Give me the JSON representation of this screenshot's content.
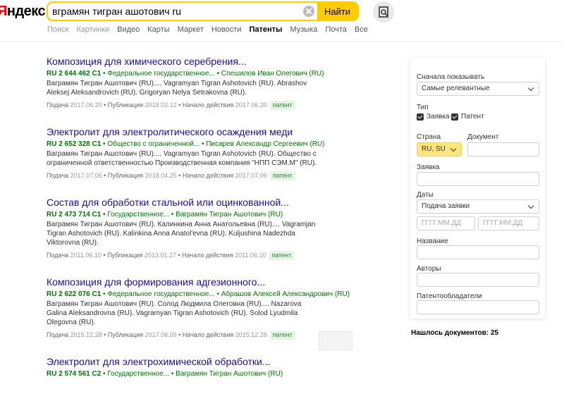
{
  "header": {
    "logo_first_letter": "Я",
    "logo_rest": "ндекс",
    "query": "вграмян тигран ашотович ru",
    "search_button": "Найти"
  },
  "tabs": [
    {
      "label": "Поиск",
      "state": "muted"
    },
    {
      "label": "Картинки",
      "state": "muted"
    },
    {
      "label": "Видео",
      "state": "normal"
    },
    {
      "label": "Карты",
      "state": "normal"
    },
    {
      "label": "Маркет",
      "state": "normal"
    },
    {
      "label": "Новости",
      "state": "normal"
    },
    {
      "label": "Патенты",
      "state": "active"
    },
    {
      "label": "Музыка",
      "state": "normal"
    },
    {
      "label": "Почта",
      "state": "normal"
    },
    {
      "label": "Все",
      "state": "normal"
    }
  ],
  "results": [
    {
      "title": "Композиция для химического серебрения...",
      "number": "RU 2 644 462 C1",
      "meta": " • Федеральное государственное... • Спешилов Иван Олегович (RU)",
      "authors": "Ваграмян Тигран Ашотович (RU).... Vagramyan Tigran Ashotovich (RU). Abrashov Aleksej Aleksandrovich (RU). Grigoryan Nelya Setrakovna (RU).",
      "filed_label": "Подача",
      "filed": "2017.06.20",
      "pub_label": "Публикация",
      "pub": "2018.02.12",
      "start_label": "Начало действия",
      "start": "2017.06.20",
      "badge": "патент"
    },
    {
      "title": "Электролит для электролитического осаждения меди",
      "number": "RU 2 652 328 C1",
      "meta": " • Общество с ограниченной... • Писарев Александр Сергеевич (RU)",
      "authors": "Ваграмян Тигран Ашотович (RU).... Vagramyan Tigran Ashotovich (RU). Общество с ограниченной ответственностью Производственная компания \"НПП СЭМ.М\" (RU).",
      "filed_label": "Подача",
      "filed": "2017.07.06",
      "pub_label": "Публикация",
      "pub": "2018.04.25",
      "start_label": "Начало действия",
      "start": "2017.07.06",
      "badge": "патент"
    },
    {
      "title": "Состав для обработки стальной или оцинкованной...",
      "number": "RU 2 473 714 C1",
      "meta": " • Государственное... • Ваграмян Тигран Ашотович (RU)",
      "authors": "Ваграмян Тигран Ашотович (RU). Калинкина Анна Анатольевна (RU).... Vagramjan Tigran Ashotovich (RU). Kalinkina Anna Anatol'evna (RU). Kuljushina Nadezhda Viktorovna (RU).",
      "filed_label": "Подача",
      "filed": "2011.06.10",
      "pub_label": "Публикация",
      "pub": "2013.01.27",
      "start_label": "Начало действия",
      "start": "2011.06.10",
      "badge": "патент"
    },
    {
      "title": "Композиция для формирования адгезионного...",
      "number": "RU 2 622 076 C1",
      "meta": " • Федеральное государственное... • Абрашов Алексей Александрович (RU)",
      "authors": "Ваграмян Тигран Ашотович (RU). Солод Людмила Олеговна (RU).... Nazarova Galina Aleksandrovna (RU). Vagramyan Tigran Ashotovich (RU). Solod Lyudmila Olegovna (RU).",
      "filed_label": "Подача",
      "filed": "2015.12.28",
      "pub_label": "Публикация",
      "pub": "2017.06.09",
      "start_label": "Начало действия",
      "start": "2015.12.28",
      "badge": "патент"
    },
    {
      "title": "Электролит для электрохимической обработки...",
      "number": "RU 2 574 561 C2",
      "meta": " • Государственное... • Ваграмян Тигран Ашотович (RU)",
      "authors": "",
      "filed_label": "",
      "filed": "",
      "pub_label": "",
      "pub": "",
      "start_label": "",
      "start": "",
      "badge": ""
    }
  ],
  "filters": {
    "sort_label": "Сначала показывать",
    "sort_value": "Самые релевантные",
    "type_label": "Тип",
    "type_application": "Заявка",
    "type_patent": "Патент",
    "country_label": "Страна",
    "country_value": "RU, SU",
    "document_label": "Документ",
    "application_label": "Заявка",
    "dates_label": "Даты",
    "dates_value": "Подача заявки",
    "date_placeholder": "ГГГГ.ММ.ДД",
    "name_label": "Название",
    "authors_label": "Авторы",
    "holders_label": "Патентообладатели"
  },
  "found_text": "Нашлось документов: 25"
}
